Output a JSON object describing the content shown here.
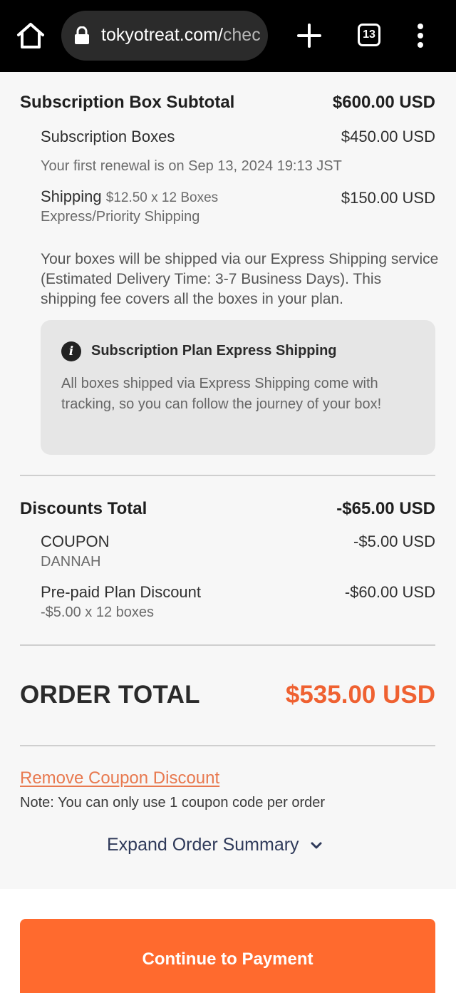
{
  "browser": {
    "url_domain": "tokyotreat.com/",
    "url_rest": "chec",
    "tab_count": "13"
  },
  "subscription": {
    "subtotal_label": "Subscription Box Subtotal",
    "subtotal_value": "$600.00 USD",
    "boxes_label": "Subscription Boxes",
    "boxes_value": "$450.00 USD",
    "renewal_text": "Your first renewal is on Sep 13, 2024 19:13 JST",
    "shipping_label": "Shipping",
    "shipping_per": "$12.50 x 12 Boxes",
    "shipping_type": "Express/Priority Shipping",
    "shipping_value": "$150.00 USD",
    "shipping_description": "Your boxes will be shipped via our Express Shipping service (Estimated Delivery Time: 3-7 Business Days). This shipping fee covers all the boxes in your plan."
  },
  "info_box": {
    "icon": "info-icon",
    "title": "Subscription Plan Express Shipping",
    "text": "All boxes shipped via Express Shipping come with tracking, so you can follow the journey of your box!"
  },
  "discounts": {
    "total_label": "Discounts Total",
    "total_value": "-$65.00 USD",
    "coupon_label": "COUPON",
    "coupon_code": "DANNAH",
    "coupon_value": "-$5.00 USD",
    "prepaid_label": "Pre-paid Plan Discount",
    "prepaid_detail": "-$5.00 x 12 boxes",
    "prepaid_value": "-$60.00 USD"
  },
  "order_total": {
    "label": "ORDER TOTAL",
    "value": "$535.00 USD"
  },
  "coupon_actions": {
    "remove_link": "Remove Coupon Discount",
    "note": "Note: You can only use 1 coupon code per order"
  },
  "expand_summary": "Expand Order Summary",
  "continue_button": "Continue to Payment",
  "colors": {
    "accent_orange": "#ff6a2e",
    "total_orange": "#ef6131",
    "link_orange": "#e8794f"
  }
}
